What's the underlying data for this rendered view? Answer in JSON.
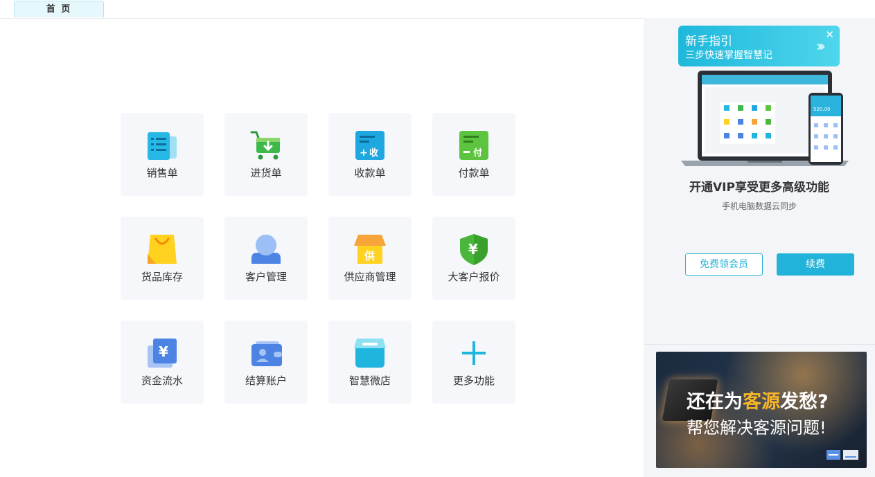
{
  "tabs": [
    {
      "label": "首 页"
    }
  ],
  "modules": [
    {
      "label": "销售单",
      "icon": "sales-order-icon"
    },
    {
      "label": "进货单",
      "icon": "purchase-cart-icon"
    },
    {
      "label": "收款单",
      "icon": "receipt-icon"
    },
    {
      "label": "付款单",
      "icon": "payment-icon"
    },
    {
      "label": "货品库存",
      "icon": "shopping-bag-icon"
    },
    {
      "label": "客户管理",
      "icon": "customer-icon"
    },
    {
      "label": "供应商管理",
      "icon": "supplier-store-icon"
    },
    {
      "label": "大客户报价",
      "icon": "yuan-shield-icon"
    },
    {
      "label": "资金流水",
      "icon": "yuan-document-icon"
    },
    {
      "label": "结算账户",
      "icon": "wallet-icon"
    },
    {
      "label": "智慧微店",
      "icon": "micro-store-icon"
    },
    {
      "label": "更多功能",
      "icon": "plus-icon"
    }
  ],
  "icon_glyphs": {
    "receipt": "收",
    "payment": "付",
    "supplier": "供",
    "yuan": "¥",
    "plus": "+",
    "close": "✕",
    "arrows": "›››"
  },
  "guide": {
    "title": "新手指引",
    "subtitle": "三步快速掌握智慧记"
  },
  "vip": {
    "title": "开通VIP享受更多高级功能",
    "subtitle": "手机电脑数据云同步",
    "phone_amount": "520.00",
    "free_button": "免费领会员",
    "renew_button": "续费"
  },
  "banner": {
    "line1_part1": "还在为",
    "line1_highlight": "客源",
    "line1_part2": "发愁?",
    "line2": "帮您解决客源问题!"
  },
  "colors": {
    "accent": "#21b3d9",
    "tile_bg": "#f5f7fa",
    "panel_bg": "#f3f5f8",
    "banner_highlight": "#f6b42a"
  }
}
